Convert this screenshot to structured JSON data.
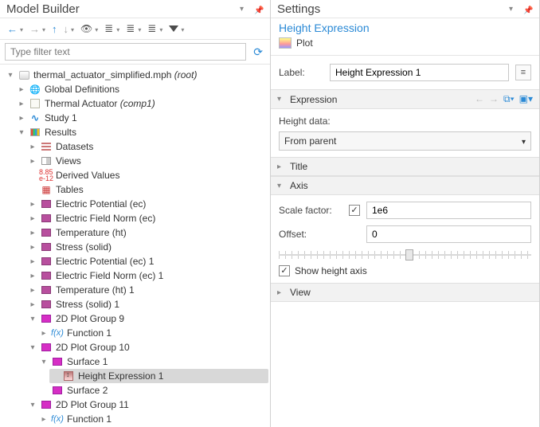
{
  "left": {
    "title": "Model Builder",
    "filter_placeholder": "Type filter text",
    "tree": {
      "root": "thermal_actuator_simplified.mph",
      "root_suffix": "(root)",
      "children": {
        "global_defs": "Global Definitions",
        "thermal_actuator": "Thermal Actuator",
        "thermal_actuator_suffix": "(comp1)",
        "study": "Study 1",
        "results": "Results",
        "datasets": "Datasets",
        "views": "Views",
        "derived": "Derived Values",
        "tables": "Tables",
        "ep_ec": "Electric Potential (ec)",
        "ef_ec": "Electric Field Norm (ec)",
        "temp_ht": "Temperature (ht)",
        "stress": "Stress (solid)",
        "ep_ec1": "Electric Potential (ec) 1",
        "ef_ec1": "Electric Field Norm (ec) 1",
        "temp_ht1": "Temperature (ht) 1",
        "stress1": "Stress (solid) 1",
        "pg9": "2D Plot Group 9",
        "func1": "Function 1",
        "pg10": "2D Plot Group 10",
        "surface1": "Surface 1",
        "hexpr1": "Height Expression 1",
        "surface2": "Surface 2",
        "pg11": "2D Plot Group 11",
        "func1b": "Function 1"
      }
    }
  },
  "right": {
    "title": "Settings",
    "subtitle": "Height Expression",
    "plot_label": "Plot",
    "label_field_label": "Label:",
    "label_value": "Height Expression 1",
    "sections": {
      "expression": "Expression",
      "title": "Title",
      "axis": "Axis",
      "view": "View"
    },
    "expr_body": {
      "height_data_label": "Height data:",
      "height_data_value": "From parent"
    },
    "axis_body": {
      "scale_label": "Scale factor:",
      "scale_value": "1e6",
      "offset_label": "Offset:",
      "offset_value": "0",
      "show_height_axis": "Show height axis"
    },
    "derived_text": "8.85\ne-12"
  }
}
